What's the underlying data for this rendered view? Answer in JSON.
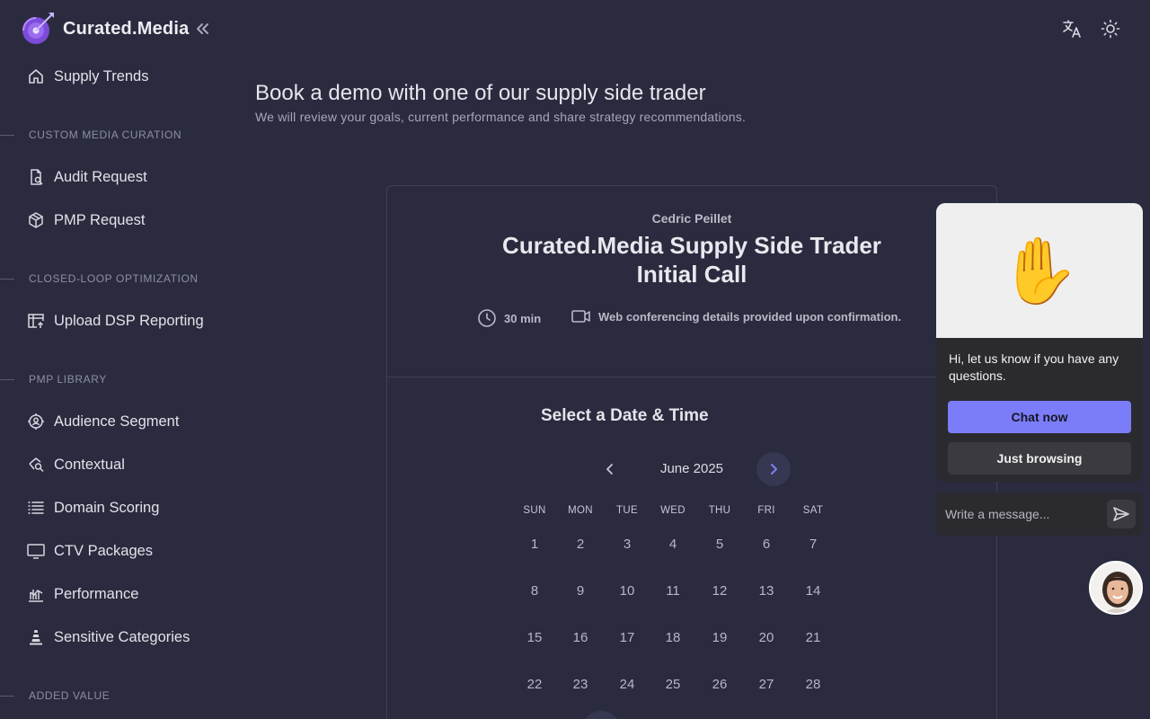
{
  "brand": {
    "name": "Curated.Media"
  },
  "sidebar": {
    "top_item": {
      "label": "Supply Trends",
      "icon": "home-icon"
    },
    "sections": [
      {
        "title": "CUSTOM MEDIA CURATION",
        "items": [
          {
            "label": "Audit Request",
            "icon": "document-search-icon"
          },
          {
            "label": "PMP Request",
            "icon": "cube-icon"
          }
        ]
      },
      {
        "title": "CLOSED-LOOP OPTIMIZATION",
        "items": [
          {
            "label": "Upload DSP Reporting",
            "icon": "table-upload-icon"
          }
        ]
      },
      {
        "title": "PMP LIBRARY",
        "items": [
          {
            "label": "Audience Segment",
            "icon": "audience-target-icon"
          },
          {
            "label": "Contextual",
            "icon": "context-search-icon"
          },
          {
            "label": "Domain Scoring",
            "icon": "list-icon"
          },
          {
            "label": "CTV Packages",
            "icon": "monitor-icon"
          },
          {
            "label": "Performance",
            "icon": "chart-icon"
          },
          {
            "label": "Sensitive Categories",
            "icon": "cone-icon"
          }
        ]
      },
      {
        "title": "ADDED VALUE",
        "items": []
      }
    ]
  },
  "header": {
    "title": "Book a demo with one of our supply side trader",
    "subtitle": "We will review your goals, current performance and share strategy recommendations."
  },
  "booking": {
    "host": "Cedric Peillet",
    "event_title": "Curated.Media Supply Side Trader Initial Call",
    "duration": "30 min",
    "conferencing": "Web conferencing details provided upon confirmation.",
    "select_heading": "Select a Date & Time",
    "month_label": "June 2025",
    "weekdays": [
      "SUN",
      "MON",
      "TUE",
      "WED",
      "THU",
      "FRI",
      "SAT"
    ],
    "weeks": [
      [
        "1",
        "2",
        "3",
        "4",
        "5",
        "6",
        "7"
      ],
      [
        "8",
        "9",
        "10",
        "11",
        "12",
        "13",
        "14"
      ],
      [
        "15",
        "16",
        "17",
        "18",
        "19",
        "20",
        "21"
      ],
      [
        "22",
        "23",
        "24",
        "25",
        "26",
        "27",
        "28"
      ]
    ]
  },
  "chat": {
    "message": "Hi, let us know if you have any questions.",
    "primary_button": "Chat now",
    "secondary_button": "Just browsing",
    "input_placeholder": "Write a message...",
    "hero_emoji": "✋"
  },
  "colors": {
    "background": "#2a2b3e",
    "accent": "#7b7df8"
  }
}
